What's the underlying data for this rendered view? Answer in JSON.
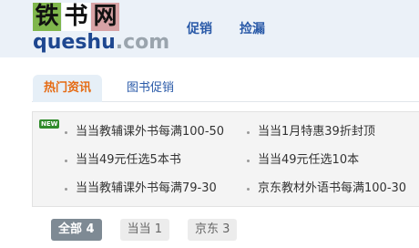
{
  "logo": {
    "chars": [
      "铁",
      "书",
      "网"
    ],
    "sub_main": "queshu",
    "sub_tld": ".com",
    "colors": [
      "#7fb64c",
      "#ffffff",
      "#d7a2a5"
    ]
  },
  "topnav": {
    "items": [
      "促销",
      "捡漏"
    ]
  },
  "tabs": [
    {
      "label": "热门资讯",
      "active": true
    },
    {
      "label": "图书促销",
      "active": false
    }
  ],
  "news": {
    "badge": "NEW",
    "items": [
      "当当教辅课外书每满100-50",
      "当当1月特惠39折封顶",
      "当当49元任选5本书",
      "当当49元任选10本",
      "当当教辅课外书每满79-30",
      "京东教材外语书每满100-30"
    ]
  },
  "filters": [
    {
      "label": "全部 4",
      "active": true
    },
    {
      "label": "当当 1",
      "active": false
    },
    {
      "label": "京东 3",
      "active": false
    }
  ],
  "colors": {
    "accent_orange": "#e56a12",
    "link_blue": "#2a5aa8",
    "new_badge_green": "#2f8a2a"
  }
}
